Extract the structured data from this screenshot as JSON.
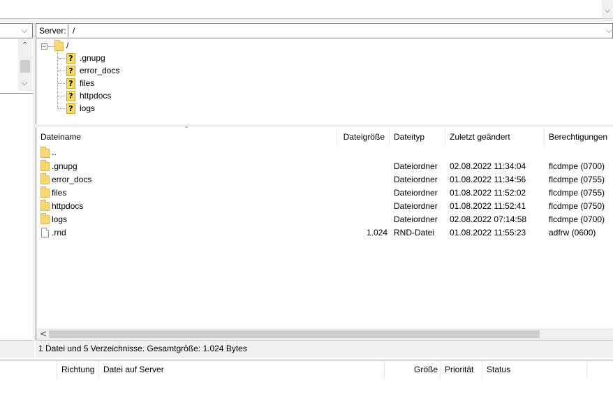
{
  "server_bar": {
    "label": "Server:",
    "path": "/"
  },
  "tree": {
    "root": "/",
    "items": [
      ".gnupg",
      "error_docs",
      "files",
      "httpdocs",
      "logs"
    ],
    "unknown_glyph": "?"
  },
  "file_list": {
    "columns": [
      "Dateiname",
      "Dateigröße",
      "Dateityp",
      "Zuletzt geändert",
      "Berechtigungen"
    ],
    "rows": [
      {
        "name": "..",
        "size": "",
        "type": "",
        "modified": "",
        "perms": "",
        "icon": "folder-icon"
      },
      {
        "name": ".gnupg",
        "size": "",
        "type": "Dateiordner",
        "modified": "02.08.2022 11:34:04",
        "perms": "flcdmpe (0700)",
        "icon": "folder-icon"
      },
      {
        "name": "error_docs",
        "size": "",
        "type": "Dateiordner",
        "modified": "01.08.2022 11:34:56",
        "perms": "flcdmpe (0755)",
        "icon": "folder-icon"
      },
      {
        "name": "files",
        "size": "",
        "type": "Dateiordner",
        "modified": "01.08.2022 11:52:02",
        "perms": "flcdmpe (0755)",
        "icon": "folder-icon"
      },
      {
        "name": "httpdocs",
        "size": "",
        "type": "Dateiordner",
        "modified": "01.08.2022 11:52:41",
        "perms": "flcdmpe (0750)",
        "icon": "folder-icon"
      },
      {
        "name": "logs",
        "size": "",
        "type": "Dateiordner",
        "modified": "02.08.2022 07:14:58",
        "perms": "flcdmpe (0700)",
        "icon": "folder-icon"
      },
      {
        "name": ".rnd",
        "size": "1.024",
        "type": "RND-Datei",
        "modified": "01.08.2022 11:55:23",
        "perms": "adfrw (0600)",
        "icon": "file-icon"
      }
    ]
  },
  "status_text": "1 Datei und 5 Verzeichnisse. Gesamtgröße: 1.024 Bytes",
  "queue": {
    "columns": [
      "Richtung",
      "Datei auf Server",
      "Größe",
      "Priorität",
      "Status"
    ]
  },
  "glyphs": {
    "chevron_down": "⌵",
    "chevron_up": "⌃",
    "scroll_left": "<",
    "collapse": "−",
    "sort_up": "⌃"
  }
}
